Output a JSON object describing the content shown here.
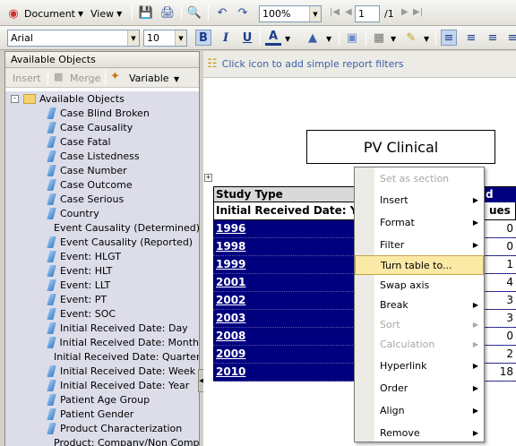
{
  "toolbar": {
    "document_label": "Document",
    "view_label": "View",
    "zoom_value": "100%",
    "page_value": "1",
    "page_total": "/1",
    "font_value": "Arial",
    "size_value": "10",
    "bold": "B",
    "italic": "I",
    "underline": "U",
    "font_color": "A"
  },
  "left_panel": {
    "title": "Available Objects",
    "insert_label": "Insert",
    "merge_label": "Merge",
    "variable_label": "Variable",
    "root_label": "Available Objects",
    "items": [
      "Case Blind Broken",
      "Case Causality",
      "Case Fatal",
      "Case Listedness",
      "Case Number",
      "Case Outcome",
      "Case Serious",
      "Country",
      "Event Causality (Determined)",
      "Event Causality (Reported)",
      "Event: HLGT",
      "Event: HLT",
      "Event: LLT",
      "Event: PT",
      "Event: SOC",
      "Initial Received Date: Day",
      "Initial Received Date: Month",
      "Initial Received Date: Quarter",
      "Initial Received Date: Week",
      "Initial Received Date: Year",
      "Patient Age Group",
      "Patient Gender",
      "Product Characterization",
      "Product: Company/Non Company"
    ]
  },
  "report": {
    "filter_hint": "Click icon to add simple report filters",
    "title": "PV Clinical",
    "header_col1": "Study Type",
    "header_col2_fragment": "d",
    "subheader_col1": "Initial Received Date: Ye",
    "subheader_col2": "ues",
    "rows": [
      {
        "year": "1996",
        "value": "0"
      },
      {
        "year": "1998",
        "value": "0"
      },
      {
        "year": "1999",
        "value": "1"
      },
      {
        "year": "2001",
        "value": "4"
      },
      {
        "year": "2002",
        "value": "3"
      },
      {
        "year": "2003",
        "value": "3"
      },
      {
        "year": "2008",
        "value": "0"
      },
      {
        "year": "2009",
        "value": "2"
      },
      {
        "year": "2010",
        "value": "18"
      }
    ]
  },
  "context_menu": {
    "items": [
      {
        "label": "Set as section",
        "disabled": true,
        "submenu": false
      },
      {
        "label": "Insert",
        "disabled": false,
        "submenu": true
      },
      {
        "label": "Format",
        "disabled": false,
        "submenu": true
      },
      {
        "label": "Filter",
        "disabled": false,
        "submenu": true
      },
      {
        "label": "Turn table to...",
        "disabled": false,
        "submenu": false,
        "highlighted": true
      },
      {
        "label": "Swap axis",
        "disabled": false,
        "submenu": false
      },
      {
        "label": "Break",
        "disabled": false,
        "submenu": true
      },
      {
        "label": "Sort",
        "disabled": true,
        "submenu": true
      },
      {
        "label": "Calculation",
        "disabled": true,
        "submenu": true
      },
      {
        "label": "Hyperlink",
        "disabled": false,
        "submenu": true
      },
      {
        "label": "Order",
        "disabled": false,
        "submenu": true
      },
      {
        "label": "Align",
        "disabled": false,
        "submenu": true
      },
      {
        "label": "Remove",
        "disabled": false,
        "submenu": true
      }
    ]
  },
  "colors": {
    "table_blue": "#00007f",
    "menu_highlight": "#fbe9a6",
    "tree_bg": "#dcdde9",
    "link_blue": "#3b60a8"
  }
}
